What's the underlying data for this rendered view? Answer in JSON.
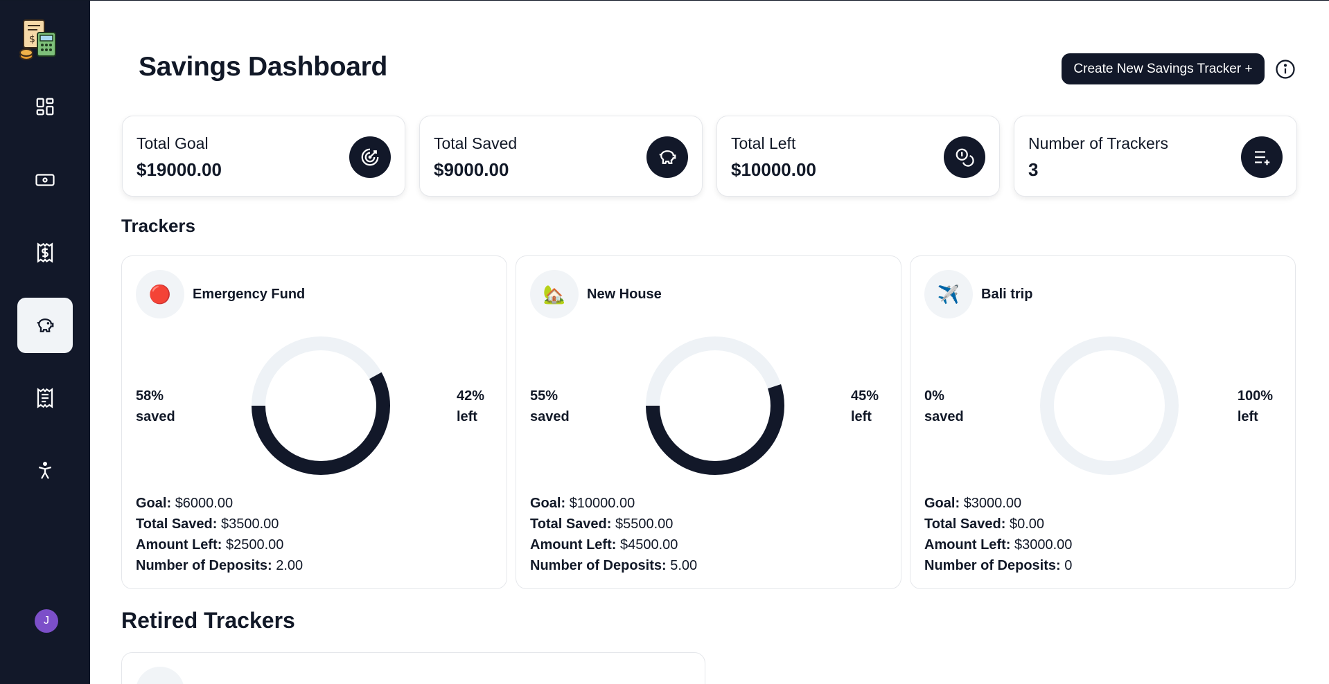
{
  "page": {
    "title": "Savings Dashboard"
  },
  "header": {
    "create_button_label": "Create New Savings Tracker +"
  },
  "stats": [
    {
      "label": "Total Goal",
      "value": "$19000.00",
      "icon": "goal-target-icon"
    },
    {
      "label": "Total Saved",
      "value": "$9000.00",
      "icon": "piggy-bank-icon"
    },
    {
      "label": "Total Left",
      "value": "$10000.00",
      "icon": "coins-icon"
    },
    {
      "label": "Number of Trackers",
      "value": "3",
      "icon": "list-add-icon"
    }
  ],
  "trackers_section": {
    "title": "Trackers"
  },
  "trackers": [
    {
      "name": "Emergency Fund",
      "emoji": "🔴",
      "saved_pct": "58%",
      "saved_word": "saved",
      "left_pct": "42%",
      "left_word": "left",
      "saved_fraction": 0.58,
      "goal_label": "Goal:",
      "goal": "$6000.00",
      "saved_label": "Total Saved:",
      "saved": "$3500.00",
      "left_label": "Amount Left:",
      "left": "$2500.00",
      "deposits_label": "Number of Deposits:",
      "deposits": "2.00"
    },
    {
      "name": "New House",
      "emoji": "🏡",
      "saved_pct": "55%",
      "saved_word": "saved",
      "left_pct": "45%",
      "left_word": "left",
      "saved_fraction": 0.55,
      "goal_label": "Goal:",
      "goal": "$10000.00",
      "saved_label": "Total Saved:",
      "saved": "$5500.00",
      "left_label": "Amount Left:",
      "left": "$4500.00",
      "deposits_label": "Number of Deposits:",
      "deposits": "5.00"
    },
    {
      "name": "Bali trip",
      "emoji": "✈️",
      "saved_pct": "0%",
      "saved_word": "saved",
      "left_pct": "100%",
      "left_word": "left",
      "saved_fraction": 0,
      "goal_label": "Goal:",
      "goal": "$3000.00",
      "saved_label": "Total Saved:",
      "saved": "$0.00",
      "left_label": "Amount Left:",
      "left": "$3000.00",
      "deposits_label": "Number of Deposits:",
      "deposits": "0"
    }
  ],
  "retired_section": {
    "title": "Retired Trackers"
  },
  "sidebar": {
    "items": [
      {
        "name": "dashboard",
        "icon": "dashboard-grid-icon"
      },
      {
        "name": "income",
        "icon": "banknote-icon"
      },
      {
        "name": "expenses",
        "icon": "receipt-dollar-icon"
      },
      {
        "name": "savings",
        "icon": "piggy-bank-icon",
        "active": true
      },
      {
        "name": "bills",
        "icon": "receipt-icon"
      },
      {
        "name": "accessibility",
        "icon": "accessibility-icon"
      }
    ],
    "user_initial": "J"
  },
  "colors": {
    "sidebar_bg": "#121829",
    "donut_saved": "#121829",
    "donut_track": "#eef2f6",
    "avatar_bg": "#7c4fc9"
  }
}
